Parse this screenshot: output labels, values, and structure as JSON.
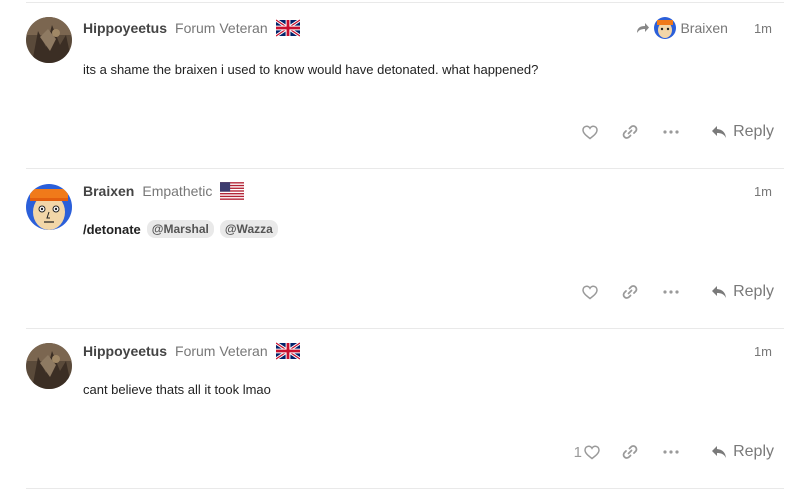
{
  "posts": [
    {
      "username": "Hippoyeetus",
      "user_title": "Forum Veteran",
      "flag": "uk-flag",
      "reply_to": "Braixen",
      "time": "1m",
      "body": "its a shame the braixen i used to know would have detonated. what happened?",
      "like_count": "",
      "reply_label": "Reply"
    },
    {
      "username": "Braixen",
      "user_title": "Empathetic",
      "flag": "us-flag",
      "time": "1m",
      "command": "/detonate",
      "mentions": [
        "@Marshal",
        "@Wazza"
      ],
      "like_count": "",
      "reply_label": "Reply"
    },
    {
      "username": "Hippoyeetus",
      "user_title": "Forum Veteran",
      "flag": "uk-flag",
      "time": "1m",
      "body": "cant believe thats all it took lmao",
      "like_count": "1",
      "reply_label": "Reply"
    }
  ],
  "icons": {
    "like": "heart-icon",
    "link": "link-icon",
    "more": "ellipsis-icon",
    "reply": "reply-arrow-icon",
    "reply_to": "share-arrow-icon"
  },
  "colors": {
    "text": "#222222",
    "muted": "#777777",
    "icon": "#9a9a9a",
    "divider": "#e9e9e9",
    "mention_bg": "#e9e9e9"
  }
}
